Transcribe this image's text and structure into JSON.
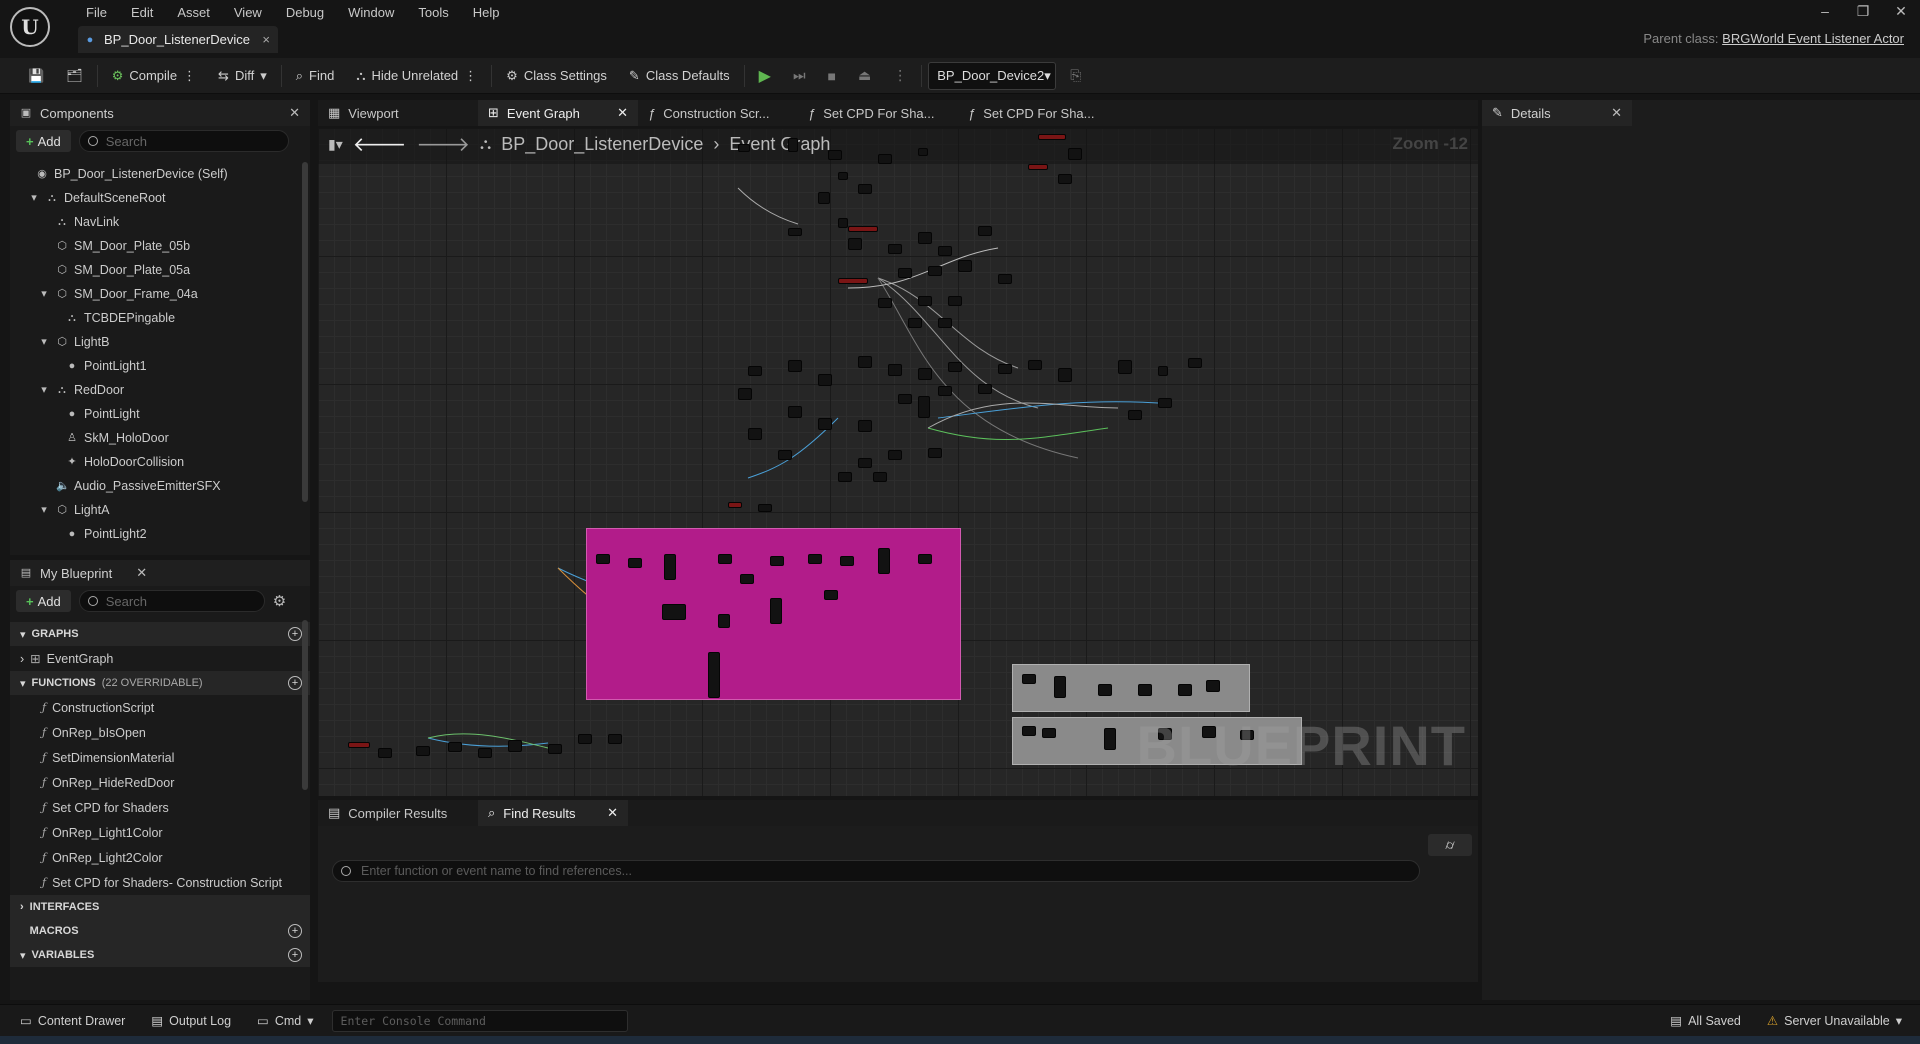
{
  "menu": [
    "File",
    "Edit",
    "Asset",
    "View",
    "Debug",
    "Window",
    "Tools",
    "Help"
  ],
  "doc_tab": {
    "title": "BP_Door_ListenerDevice",
    "close": "×"
  },
  "parent_class": {
    "label": "Parent class:",
    "value": "BRGWorld Event Listener Actor"
  },
  "window_buttons": [
    "–",
    "❐",
    "✕"
  ],
  "toolbar": {
    "compile": "Compile",
    "diff": "Diff",
    "find": "Find",
    "hide_unrelated": "Hide Unrelated",
    "class_settings": "Class Settings",
    "class_defaults": "Class Defaults",
    "debug_object": "BP_Door_Device2"
  },
  "components": {
    "title": "Components",
    "add": "Add",
    "search_placeholder": "Search",
    "tree": [
      {
        "label": "BP_Door_ListenerDevice (Self)",
        "indent": 0,
        "icon": "self-icon"
      },
      {
        "label": "DefaultSceneRoot",
        "indent": 1,
        "icon": "scene-icon"
      },
      {
        "label": "NavLink",
        "indent": 2,
        "icon": "navlink-icon"
      },
      {
        "label": "SM_Door_Plate_05b",
        "indent": 2,
        "icon": "static-mesh-icon"
      },
      {
        "label": "SM_Door_Plate_05a",
        "indent": 2,
        "icon": "static-mesh-icon"
      },
      {
        "label": "SM_Door_Frame_04a",
        "indent": 2,
        "icon": "static-mesh-icon"
      },
      {
        "label": "TCBDEPingable",
        "indent": 3,
        "icon": "component-icon"
      },
      {
        "label": "LightB",
        "indent": 2,
        "icon": "static-mesh-icon"
      },
      {
        "label": "PointLight1",
        "indent": 3,
        "icon": "light-icon"
      },
      {
        "label": "RedDoor",
        "indent": 2,
        "icon": "scene-icon"
      },
      {
        "label": "PointLight",
        "indent": 3,
        "icon": "light-icon"
      },
      {
        "label": "SkM_HoloDoor",
        "indent": 3,
        "icon": "skeletal-mesh-icon"
      },
      {
        "label": "HoloDoorCollision",
        "indent": 3,
        "icon": "collision-icon"
      },
      {
        "label": "Audio_PassiveEmitterSFX",
        "indent": 2,
        "icon": "audio-icon"
      },
      {
        "label": "LightA",
        "indent": 2,
        "icon": "static-mesh-icon"
      },
      {
        "label": "PointLight2",
        "indent": 3,
        "icon": "light-icon"
      }
    ]
  },
  "my_blueprint": {
    "title": "My Blueprint",
    "add": "Add",
    "search_placeholder": "Search",
    "graphs_label": "GRAPHS",
    "event_graph": "EventGraph",
    "functions_label": "FUNCTIONS",
    "functions_count": "(22 OVERRIDABLE)",
    "functions": [
      "ConstructionScript",
      "OnRep_bIsOpen",
      "SetDimensionMaterial",
      "OnRep_HideRedDoor",
      "Set CPD for Shaders",
      "OnRep_Light1Color",
      "OnRep_Light2Color",
      "Set CPD for Shaders- Construction Script"
    ],
    "interfaces_label": "INTERFACES",
    "macros_label": "MACROS",
    "variables_label": "VARIABLES"
  },
  "editor_tabs": [
    {
      "label": "Viewport",
      "active": false
    },
    {
      "label": "Event Graph",
      "active": true
    },
    {
      "label": "Construction Scr...",
      "active": false
    },
    {
      "label": "Set CPD For Sha...",
      "active": false
    },
    {
      "label": "Set CPD For Sha...",
      "active": false
    }
  ],
  "graph": {
    "breadcrumb_root": "BP_Door_ListenerDevice",
    "breadcrumb_leaf": "Event Graph",
    "zoom": "Zoom -12",
    "watermark": "BLUEPRINT",
    "comment_color": "#b21c8a"
  },
  "bottom": {
    "tab_compiler": "Compiler Results",
    "tab_find": "Find Results",
    "find_placeholder": "Enter function or event name to find references..."
  },
  "details": {
    "title": "Details"
  },
  "status": {
    "content_drawer": "Content Drawer",
    "output_log": "Output Log",
    "cmd": "Cmd",
    "console_placeholder": "Enter Console Command",
    "all_saved": "All Saved",
    "server": "Server Unavailable"
  }
}
